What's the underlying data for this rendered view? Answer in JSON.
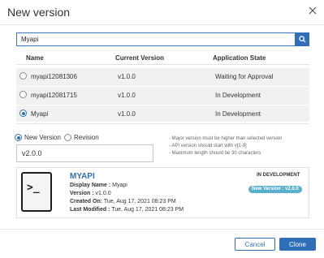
{
  "dialog": {
    "title": "New version"
  },
  "search": {
    "value": "Myapi",
    "placeholder": ""
  },
  "table": {
    "headers": [
      "Name",
      "Current Version",
      "Application State"
    ],
    "rows": [
      {
        "name": "myapi12081306",
        "version": "v1.0.0",
        "state": "Waiting for Approval",
        "selected": false
      },
      {
        "name": "myapi12081715",
        "version": "v1.0.0",
        "state": "In Development",
        "selected": false
      },
      {
        "name": "Myapi",
        "version": "v1.0.0",
        "state": "In Development",
        "selected": true
      }
    ]
  },
  "version_type": {
    "options": [
      {
        "label": "New Version",
        "selected": true
      },
      {
        "label": "Revision",
        "selected": false
      }
    ],
    "value": "v2.0.0"
  },
  "hints": [
    "- Major version must be higher than selected version",
    "- API version should start with v[1-9]",
    "- Maximum length should be 30 characters"
  ],
  "card": {
    "icon": "terminal-icon",
    "prompt_text": ">_",
    "name": "MYAPI",
    "display_name_label": "Display Name :",
    "display_name_value": "Myapi",
    "version_label": "Version :",
    "version_value": "v1.0.0",
    "created_label": "Created On:",
    "created_value": "Tue, Aug 17, 2021 08:23 PM",
    "modified_label": "Last Modified :",
    "modified_value": "Tue, Aug 17, 2021 08:23 PM",
    "state": "IN DEVELOPMENT",
    "new_version_badge": "New Version : v2.0.0"
  },
  "footer": {
    "cancel_label": "Cancel",
    "clone_label": "Clone"
  },
  "colors": {
    "accent": "#2f6fba",
    "badge": "#5ab0cc"
  }
}
